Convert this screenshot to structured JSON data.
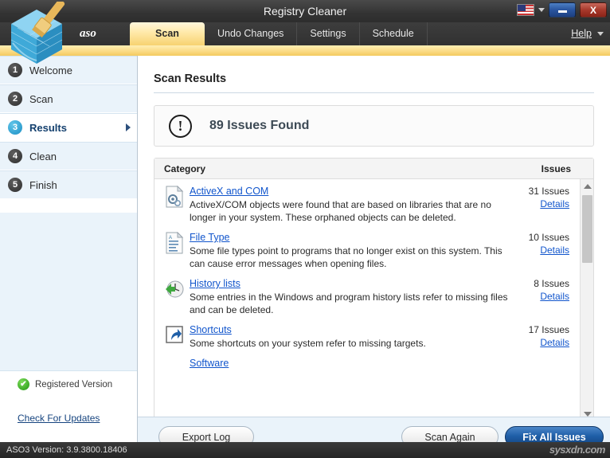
{
  "window": {
    "title": "Registry Cleaner",
    "flag_icon": "us-flag-icon",
    "flag_caret_icon": "chevron-down-icon",
    "minimize_label": "",
    "close_label": "X"
  },
  "brand": {
    "name": "aso",
    "logo_icon": "cube-brush-logo-icon"
  },
  "tabs": [
    {
      "label": "Scan",
      "active": true
    },
    {
      "label": "Undo Changes",
      "active": false
    },
    {
      "label": "Settings",
      "active": false
    },
    {
      "label": "Schedule",
      "active": false
    }
  ],
  "help": {
    "label": "Help",
    "caret_icon": "chevron-down-icon"
  },
  "sidebar": {
    "items": [
      {
        "num": "1",
        "label": "Welcome",
        "active": false
      },
      {
        "num": "2",
        "label": "Scan",
        "active": false
      },
      {
        "num": "3",
        "label": "Results",
        "active": true
      },
      {
        "num": "4",
        "label": "Clean",
        "active": false
      },
      {
        "num": "5",
        "label": "Finish",
        "active": false
      }
    ],
    "registered": {
      "icon": "check-circle-icon",
      "check_glyph": "✔",
      "label": "Registered Version"
    },
    "updates_link": "Check For Updates"
  },
  "main": {
    "page_title": "Scan Results",
    "banner": {
      "icon": "exclamation-circle-icon",
      "glyph": "!",
      "text": "89 Issues Found"
    },
    "columns": {
      "category": "Category",
      "issues": "Issues"
    },
    "categories": [
      {
        "icon": "activex-com-icon",
        "name": "ActiveX and COM",
        "description": "ActiveX/COM objects were found that are based on libraries that are no longer in your system. These orphaned objects can be deleted.",
        "count": "31 Issues",
        "details": "Details"
      },
      {
        "icon": "file-type-icon",
        "name": "File Type",
        "description": "Some file types point to programs that no longer exist on this system. This can cause error messages when opening files.",
        "count": "10 Issues",
        "details": "Details"
      },
      {
        "icon": "history-lists-icon",
        "name": "History lists",
        "description": "Some entries in the Windows and program history lists refer to missing files and can be deleted.",
        "count": "8 Issues",
        "details": "Details"
      },
      {
        "icon": "shortcuts-icon",
        "name": "Shortcuts",
        "description": "Some shortcuts on your system refer to missing targets.",
        "count": "17 Issues",
        "details": "Details"
      },
      {
        "icon": "software-icon",
        "name": "Software",
        "description": "",
        "count": "",
        "details": ""
      }
    ],
    "scrollbar": {
      "up_icon": "chevron-up-icon",
      "down_icon": "chevron-down-icon"
    }
  },
  "footer": {
    "export_log": "Export Log",
    "scan_again": "Scan Again",
    "fix_all": "Fix All Issues"
  },
  "statusbar": {
    "version": "ASO3 Version: 3.9.3800.18406",
    "watermark": "sysxdn.com"
  },
  "colors": {
    "accent_gold": "#f3c95f",
    "accent_blue": "#1f5fa8",
    "link_blue": "#1155cc",
    "sidebar_bg": "#eaf3fa"
  }
}
